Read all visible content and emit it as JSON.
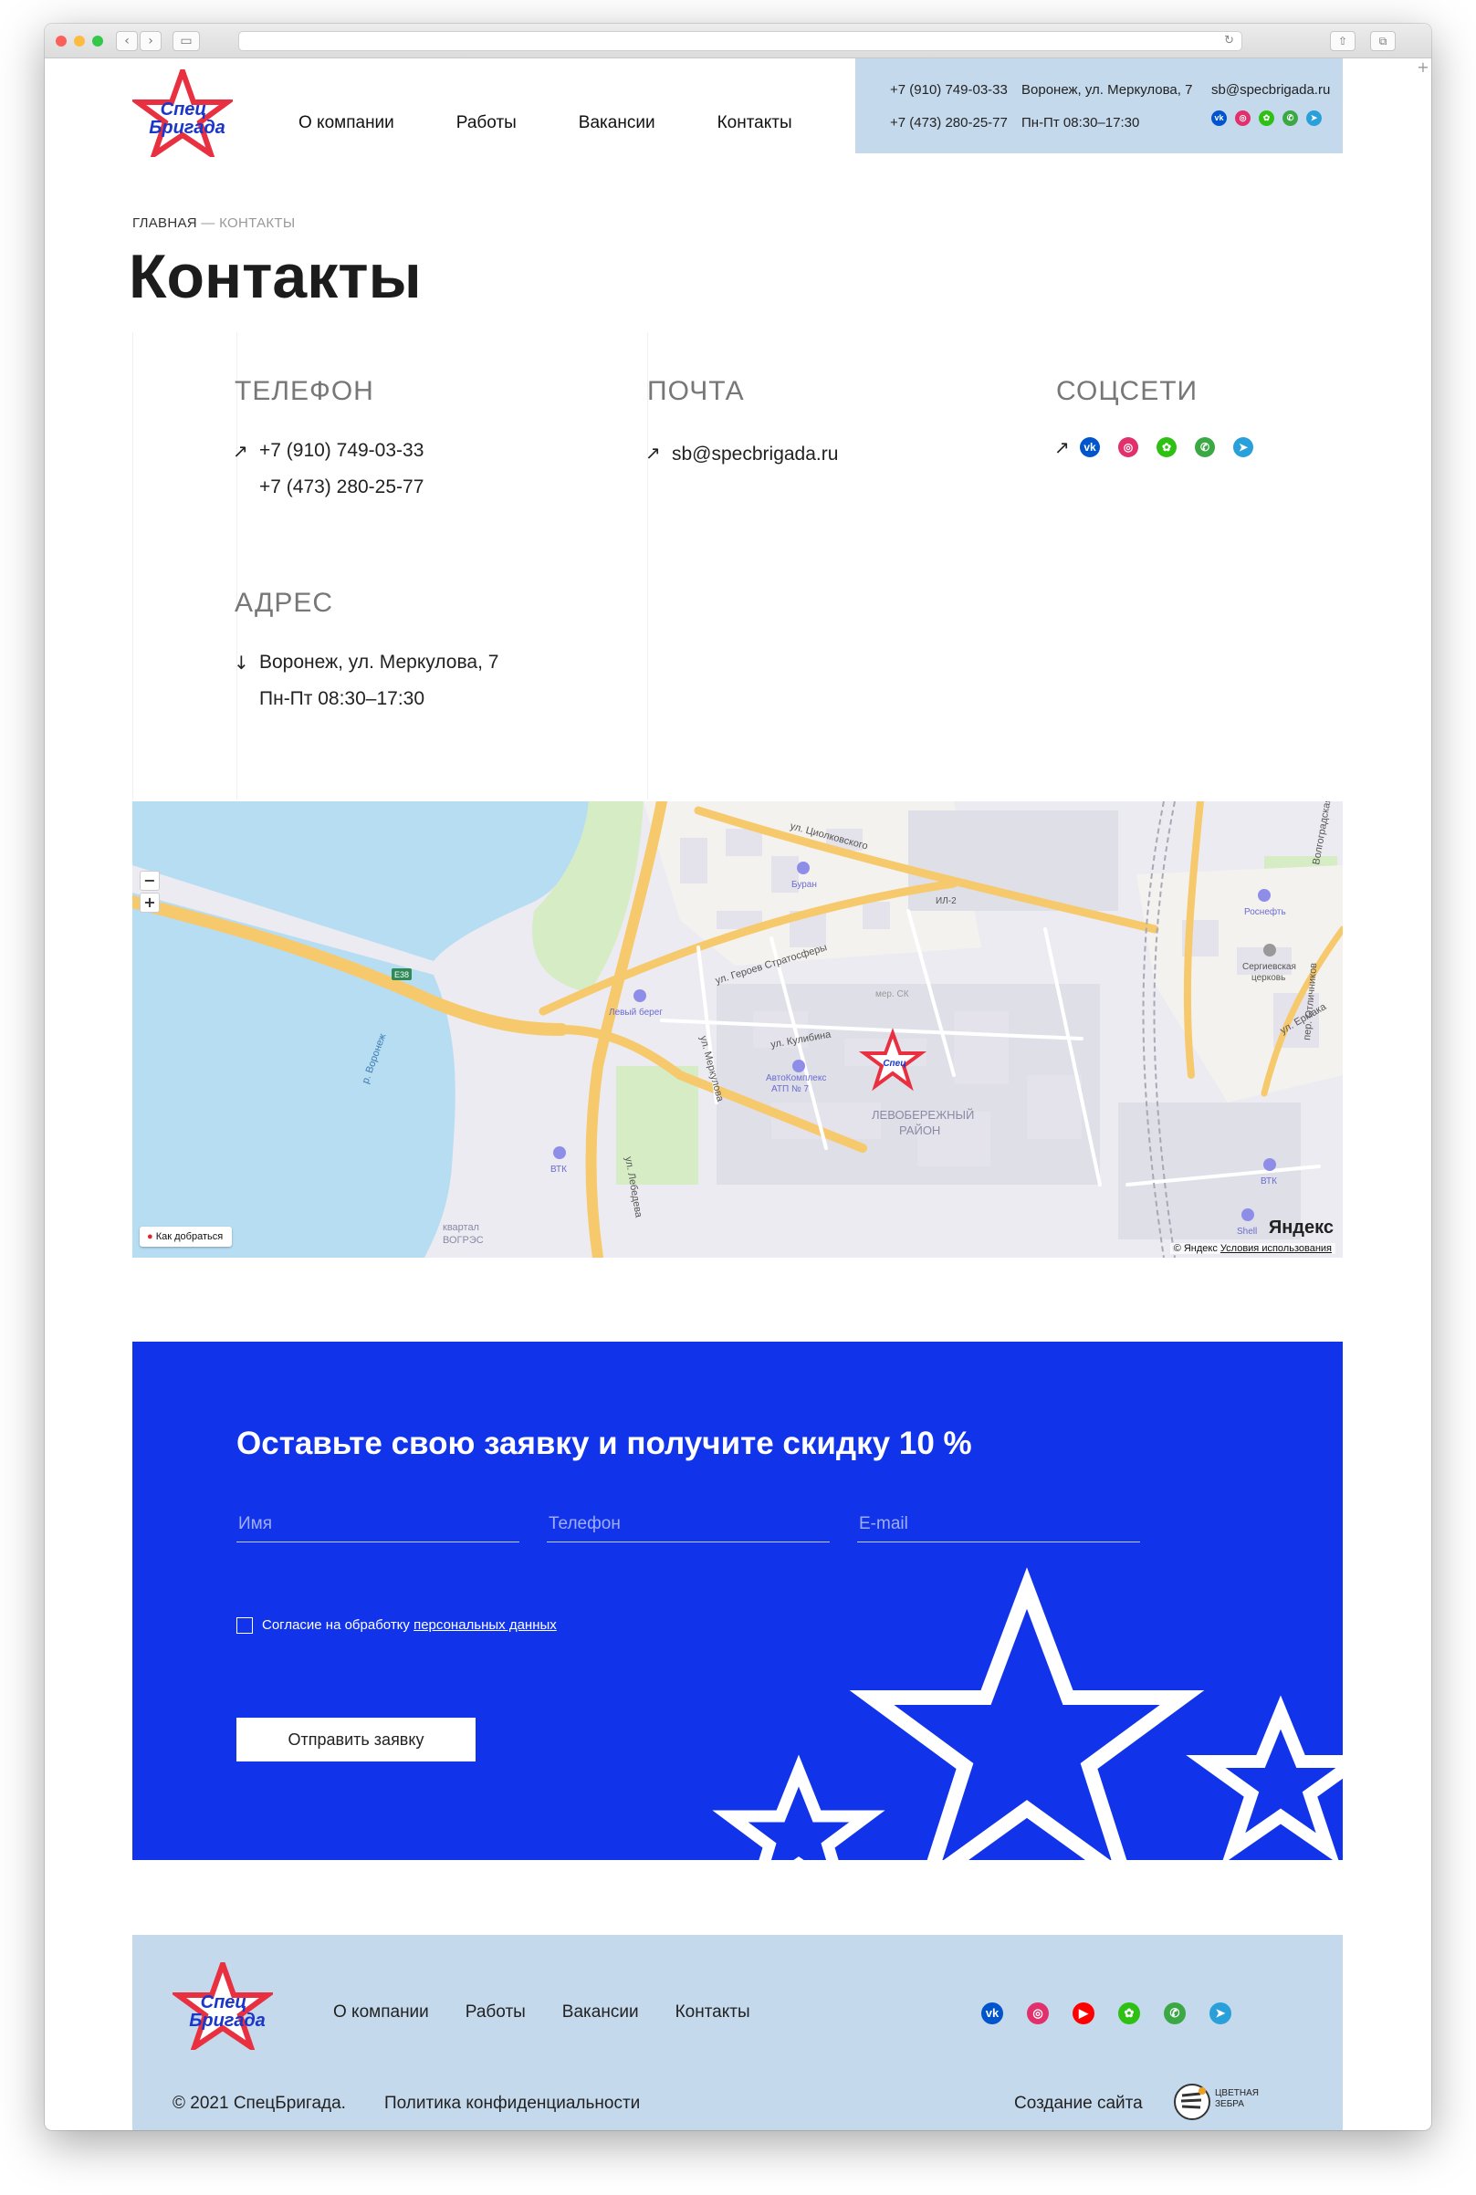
{
  "brand": {
    "logo_text_line1": "Спец",
    "logo_text_line2": "Бригада",
    "accent_color": "#1133ea",
    "light_color": "#c5d9ec",
    "star_red": "#e83040"
  },
  "nav": {
    "items": [
      "О компании",
      "Работы",
      "Вакансии",
      "Контакты"
    ]
  },
  "top_contacts": {
    "phone1": "+7 (910) 749-03-33",
    "phone2": "+7 (473) 280-25-77",
    "address": "Воронеж, ул. Меркулова, 7",
    "hours": "Пн-Пт 08:30–17:30",
    "email": "sb@specbrigada.ru"
  },
  "breadcrumb": {
    "home": "ГЛАВНАЯ",
    "sep": " — ",
    "current": "КОНТАКТЫ"
  },
  "page_title": "Контакты",
  "contacts": {
    "phone_heading": "ТЕЛЕФОН",
    "phone1": "+7 (910) 749-03-33",
    "phone2": "+7 (473) 280-25-77",
    "mail_heading": "ПОЧТА",
    "email": "sb@specbrigada.ru",
    "social_heading": "СОЦСЕТИ",
    "address_heading": "АДРЕС",
    "address": "Воронеж, ул. Меркулова, 7",
    "hours": "Пн-Пт 08:30–17:30"
  },
  "socials": [
    {
      "icon": "vk-icon",
      "color": "#0055cc",
      "glyph": "vk"
    },
    {
      "icon": "instagram-icon",
      "color": "#e1306c",
      "glyph": "◎"
    },
    {
      "icon": "odnoklassniki-icon",
      "color": "#2ec012",
      "glyph": "✿"
    },
    {
      "icon": "whatsapp-icon",
      "color": "#3ca845",
      "glyph": "✆"
    },
    {
      "icon": "telegram-icon",
      "color": "#2aa0da",
      "glyph": "➤"
    }
  ],
  "map": {
    "labels": {
      "street1": "ул. Циолковского",
      "street2": "ул. Героев Стратосферы",
      "street3": "ул. Кулибина",
      "street4": "ул. Меркулова",
      "street5": "ул. Лебедева",
      "street6": "пер. Отличников",
      "street7": "ул. Ермака",
      "street8": "Волгоградская",
      "river": "р. Воронеж",
      "district_l1": "ЛЕВОБЕРЕЖНЫЙ",
      "district_l2": "РАЙОН",
      "kvartal_l1": "квартал",
      "kvartal_l2": "ВОГРЭС",
      "poi1": "Буран",
      "poi2": "ИЛ-2",
      "poi3": "Роснефть",
      "poi4_l1": "Сергиевская",
      "poi4_l2": "церковь",
      "poi5": "Левый берег",
      "poi6_l1": "АвтоКомплекс",
      "poi6_l2": "АТП № 7",
      "poi7": "ВТК",
      "poi8": "ВТК",
      "poi9": "Shell",
      "poi10": "мер. СК",
      "road": "Е38"
    },
    "zoom_out": "−",
    "zoom_in": "+",
    "route_button": "Как добраться",
    "copyright": "© Яндекс",
    "terms": "Условия использования",
    "provider_logo": "Яндекс"
  },
  "form": {
    "title": "Оставьте свою заявку и получите скидку 10 %",
    "name_placeholder": "Имя",
    "phone_placeholder": "Телефон",
    "email_placeholder": "E-mail",
    "consent_text": "Согласие на обработку ",
    "consent_link": "персональных данных",
    "submit_label": "Отправить заявку"
  },
  "footer": {
    "nav": [
      "О компании",
      "Работы",
      "Вакансии",
      "Контакты"
    ],
    "copyright": "© 2021 СпецБригада.",
    "privacy": "Политика конфиденциальности",
    "made_by": "Создание сайта",
    "studio_l1": "цветная",
    "studio_l2": "зебра",
    "socials": [
      {
        "icon": "vk-icon",
        "color": "#0055cc",
        "glyph": "vk"
      },
      {
        "icon": "instagram-icon",
        "color": "#e1306c",
        "glyph": "◎"
      },
      {
        "icon": "youtube-icon",
        "color": "#ff0000",
        "glyph": "▶"
      },
      {
        "icon": "odnoklassniki-icon",
        "color": "#2ec012",
        "glyph": "✿"
      },
      {
        "icon": "whatsapp-icon",
        "color": "#3ca845",
        "glyph": "✆"
      },
      {
        "icon": "telegram-icon",
        "color": "#2aa0da",
        "glyph": "➤"
      }
    ]
  }
}
